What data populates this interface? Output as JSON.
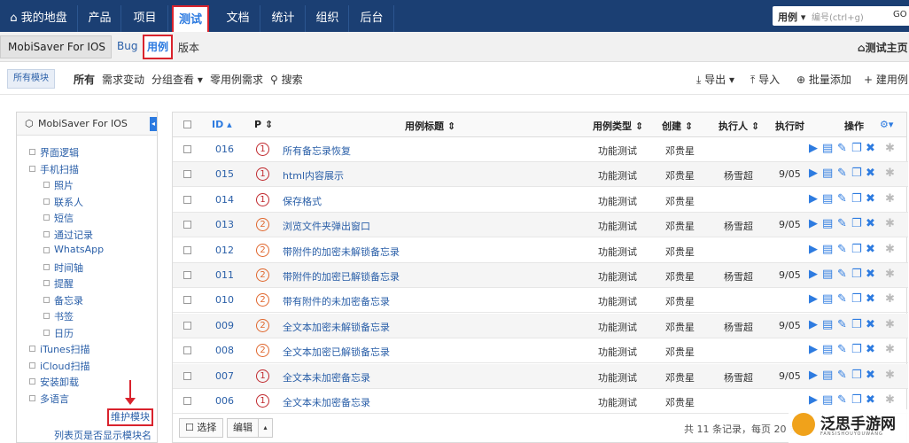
{
  "topnav": {
    "items": [
      {
        "label": "我的地盘"
      },
      {
        "label": "产品"
      },
      {
        "label": "项目"
      },
      {
        "label": "测试"
      },
      {
        "label": "文档"
      },
      {
        "label": "统计"
      },
      {
        "label": "组织"
      },
      {
        "label": "后台"
      }
    ],
    "search_scope": "用例",
    "search_placeholder": "编号(ctrl+g)",
    "search_button": "GO"
  },
  "subnav": {
    "product": "MobiSaver For IOS",
    "items": [
      {
        "label": "Bug"
      },
      {
        "label": "用例"
      },
      {
        "label": "版本"
      }
    ],
    "right_label": "测试主页"
  },
  "toolbar": {
    "module_tag": "所有模块",
    "filters": [
      {
        "label": "所有"
      },
      {
        "label": "需求变动"
      },
      {
        "label": "分组查看"
      },
      {
        "label": "零用例需求"
      },
      {
        "label": "搜索"
      }
    ],
    "actions": [
      {
        "label": "导出"
      },
      {
        "label": "导入"
      },
      {
        "label": "批量添加"
      },
      {
        "label": "建用例"
      }
    ]
  },
  "sidebar": {
    "title": "MobiSaver For IOS",
    "tree": [
      {
        "label": "界面逻辑"
      },
      {
        "label": "手机扫描"
      },
      {
        "label": "照片"
      },
      {
        "label": "联系人"
      },
      {
        "label": "短信"
      },
      {
        "label": "通过记录"
      },
      {
        "label": "WhatsApp"
      },
      {
        "label": "时间轴"
      },
      {
        "label": "提醒"
      },
      {
        "label": "备忘录"
      },
      {
        "label": "书签"
      },
      {
        "label": "日历"
      },
      {
        "label": "iTunes扫描"
      },
      {
        "label": "iCloud扫描"
      },
      {
        "label": "安装卸载"
      },
      {
        "label": "多语言"
      }
    ],
    "maintain_button": "维护模块",
    "hint": "列表页是否显示模块名"
  },
  "grid": {
    "headers": {
      "id": "ID",
      "p": "P",
      "title": "用例标题",
      "type": "用例类型",
      "creator": "创建",
      "executor": "执行人",
      "exec_time": "执行时",
      "actions": "操作"
    },
    "rows": [
      {
        "id": "016",
        "p": "1",
        "title": "所有备忘录恢复",
        "type": "功能测试",
        "creator": "邓贵星",
        "executor": "",
        "time": ""
      },
      {
        "id": "015",
        "p": "1",
        "title": "html内容展示",
        "type": "功能测试",
        "creator": "邓贵星",
        "executor": "杨雪超",
        "time": "9/05"
      },
      {
        "id": "014",
        "p": "1",
        "title": "保存格式",
        "type": "功能测试",
        "creator": "邓贵星",
        "executor": "",
        "time": ""
      },
      {
        "id": "013",
        "p": "2",
        "title": "浏览文件夹弹出窗口",
        "type": "功能测试",
        "creator": "邓贵星",
        "executor": "杨雪超",
        "time": "9/05"
      },
      {
        "id": "012",
        "p": "2",
        "title": "带附件的加密未解锁备忘录",
        "type": "功能测试",
        "creator": "邓贵星",
        "executor": "",
        "time": ""
      },
      {
        "id": "011",
        "p": "2",
        "title": "带附件的加密已解锁备忘录",
        "type": "功能测试",
        "creator": "邓贵星",
        "executor": "杨雪超",
        "time": "9/05"
      },
      {
        "id": "010",
        "p": "2",
        "title": "带有附件的未加密备忘录",
        "type": "功能测试",
        "creator": "邓贵星",
        "executor": "",
        "time": ""
      },
      {
        "id": "009",
        "p": "2",
        "title": "全文本加密未解锁备忘录",
        "type": "功能测试",
        "creator": "邓贵星",
        "executor": "杨雪超",
        "time": "9/05"
      },
      {
        "id": "008",
        "p": "2",
        "title": "全文本加密已解锁备忘录",
        "type": "功能测试",
        "creator": "邓贵星",
        "executor": "",
        "time": ""
      },
      {
        "id": "007",
        "p": "1",
        "title": "全文本未加密备忘录",
        "type": "功能测试",
        "creator": "邓贵星",
        "executor": "杨雪超",
        "time": "9/05"
      },
      {
        "id": "006",
        "p": "1",
        "title": "全文本未加密备忘录",
        "type": "功能测试",
        "creator": "邓贵星",
        "executor": "",
        "time": ""
      }
    ]
  },
  "footer": {
    "select_label": "选择",
    "edit_label": "编辑",
    "record_info": "共 11 条记录，每页 20 条"
  },
  "watermark": {
    "text": "泛思手游网",
    "sub": "FANSISHOUYOUWANG"
  },
  "colors": {
    "nav_bg": "#1b3f73",
    "accent": "#2d7be0",
    "highlight": "#d9232d",
    "p1": "#c0282d",
    "p2": "#e0662c"
  }
}
